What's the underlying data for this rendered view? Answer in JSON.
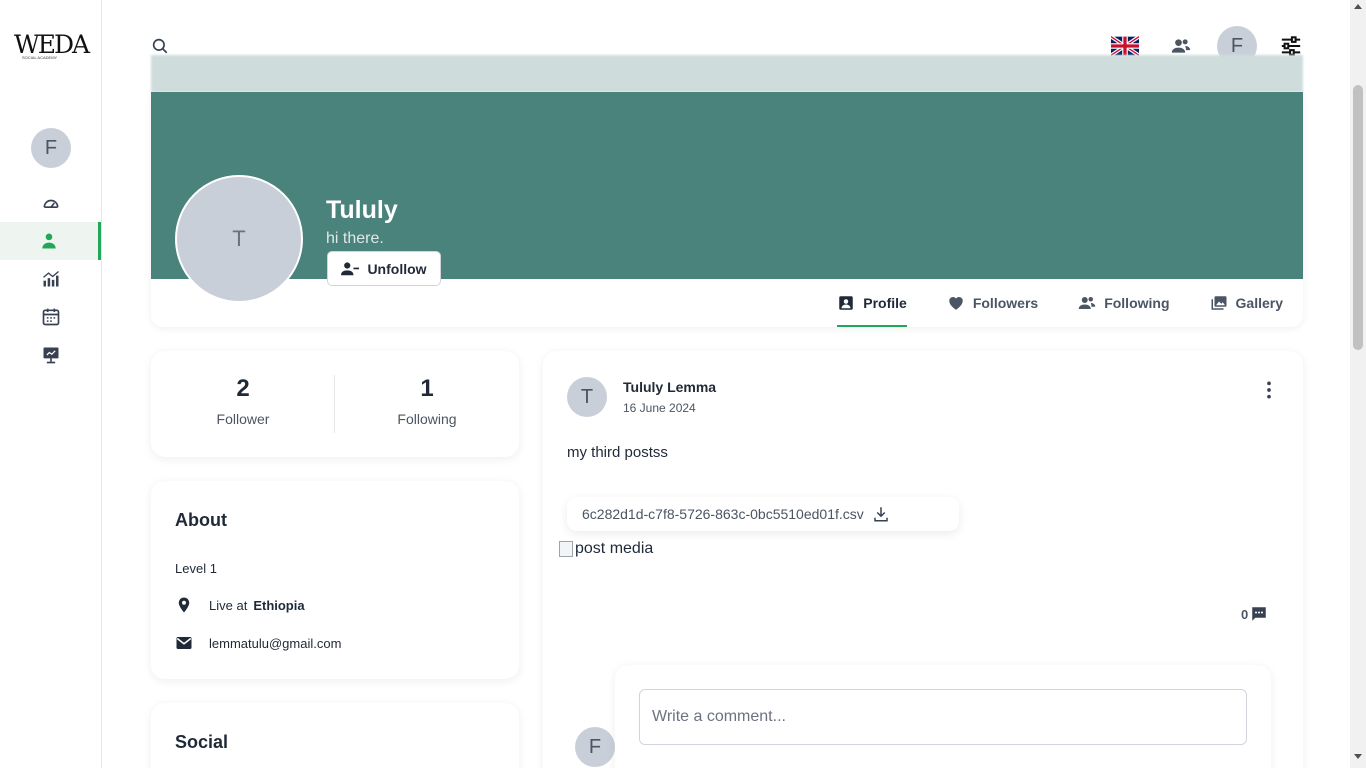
{
  "logo": {
    "text": "WEDA",
    "sub": "SOCIAL ACADEMY"
  },
  "sidebar": {
    "avatar_initial": "F",
    "items": [
      {
        "name": "dashboard",
        "icon": "gauge-icon"
      },
      {
        "name": "profile",
        "icon": "user-icon",
        "active": true
      },
      {
        "name": "analytics",
        "icon": "chart-icon"
      },
      {
        "name": "calendar",
        "icon": "calendar-icon"
      },
      {
        "name": "presentation",
        "icon": "presentation-icon"
      }
    ]
  },
  "topbar": {
    "search_icon": "search-icon",
    "language_icon": "uk-flag-icon",
    "people_icon": "people-icon",
    "avatar_initial": "F",
    "settings_icon": "sliders-icon"
  },
  "profile": {
    "avatar_initial": "T",
    "name": "Tululy",
    "bio": "hi there.",
    "unfollow_label": "Unfollow",
    "cover_color": "#4a827c",
    "tabs": [
      {
        "label": "Profile",
        "icon": "contact-card-icon",
        "active": true
      },
      {
        "label": "Followers",
        "icon": "heart-icon"
      },
      {
        "label": "Following",
        "icon": "people-icon"
      },
      {
        "label": "Gallery",
        "icon": "gallery-icon"
      }
    ]
  },
  "stats": {
    "followers": {
      "value": "2",
      "label": "Follower"
    },
    "following": {
      "value": "1",
      "label": "Following"
    }
  },
  "about": {
    "title": "About",
    "level": "Level 1",
    "live_prefix": "Live at",
    "location": "Ethiopia",
    "email": "lemmatulu@gmail.com"
  },
  "social": {
    "title": "Social"
  },
  "post": {
    "avatar_initial": "T",
    "author": "Tululy Lemma",
    "date": "16 June 2024",
    "text": "my third postss",
    "file_name": "6c282d1d-c7f8-5726-863c-0bc5510ed01f.csv",
    "media_alt": "post media",
    "comment_count": "0",
    "comment_placeholder": "Write a comment...",
    "commenter_initial": "F"
  },
  "colors": {
    "accent": "#22a75a",
    "cover": "#4a827c"
  }
}
